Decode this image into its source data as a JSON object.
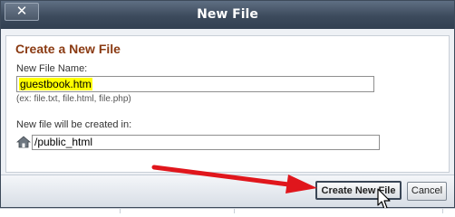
{
  "dialog": {
    "title": "New File",
    "close_label": "✕",
    "heading": "Create a New File",
    "file_name_label": "New File Name:",
    "file_name_value": "guestbook.htm",
    "file_name_hint": "(ex: file.txt, file.html, file.php)",
    "location_label": "New file will be created in:",
    "location_value": "/public_html",
    "create_button": "Create New File",
    "cancel_button": "Cancel"
  },
  "icons": {
    "close": "close-icon",
    "home": "home-icon",
    "arrow": "red-arrow-annotation",
    "cursor": "mouse-pointer-icon"
  },
  "colors": {
    "titlebar": "#3c4a5c",
    "heading": "#8a3a12",
    "highlight": "#ffff00",
    "annotation_arrow": "#e0161c"
  }
}
